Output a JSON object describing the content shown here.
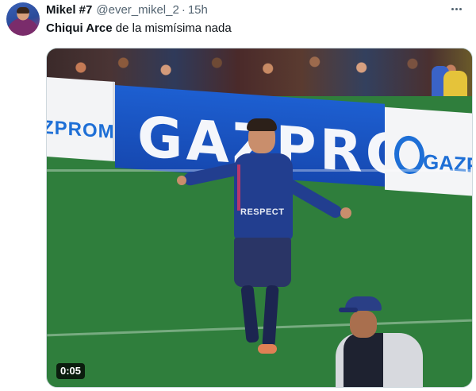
{
  "tweet": {
    "author_name": "Mikel #7",
    "handle": "@ever_mikel_2",
    "separator": "·",
    "time": "15h",
    "text_bold": "Chiqui Arce",
    "text_rest": " de la mismísima nada"
  },
  "media": {
    "board_left_text": "ZPROM",
    "board_main_text": "GAZPROM",
    "board_right_text": "GAZP",
    "shirt_text": "RESPECT",
    "duration": "0:05"
  },
  "icons": {
    "more": "more-horizontal-icon"
  },
  "colors": {
    "text_primary": "#0f1419",
    "text_secondary": "#536471",
    "board_blue": "#1d5fd1",
    "pitch_green": "#2f7e3c"
  }
}
